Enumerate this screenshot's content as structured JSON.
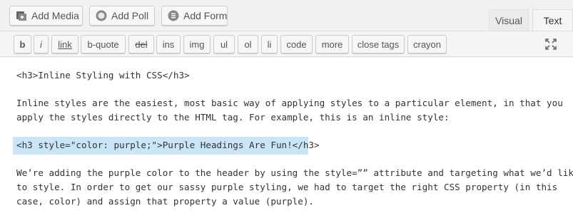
{
  "media_buttons": [
    {
      "label": "Add Media",
      "icon": "media-icon"
    },
    {
      "label": "Add Poll",
      "icon": "poll-icon"
    },
    {
      "label": "Add Form",
      "icon": "form-icon"
    }
  ],
  "tabs": {
    "visual": "Visual",
    "text": "Text",
    "active": "text"
  },
  "toolbar": {
    "buttons": [
      "b",
      "i",
      "link",
      "b-quote",
      "del",
      "ins",
      "img",
      "ul",
      "ol",
      "li",
      "code",
      "more",
      "close tags",
      "crayon"
    ],
    "fullscreen_icon": "fullscreen-icon"
  },
  "editor": {
    "line1": "<h3>Inline Styling with CSS</h3>",
    "para1_line1": "Inline styles are the easiest, most basic way of applying styles to a particular element, in that you",
    "para1_line2": "apply the styles directly to the HTML tag. For example, this is an inline style:",
    "code_line": "<h3 style=\"color: purple;\">Purple Headings Are Fun!</h3>",
    "para2_line1": "We’re adding the purple color to the header by using the style=”” attribute and targeting what we’d like",
    "para2_line2": "to style. In order to get our sassy purple styling, we had to target the right CSS property (in this",
    "para2_line3": "case, color) and assign that property a value (purple).",
    "highlight_color": "#c9e5f7"
  }
}
